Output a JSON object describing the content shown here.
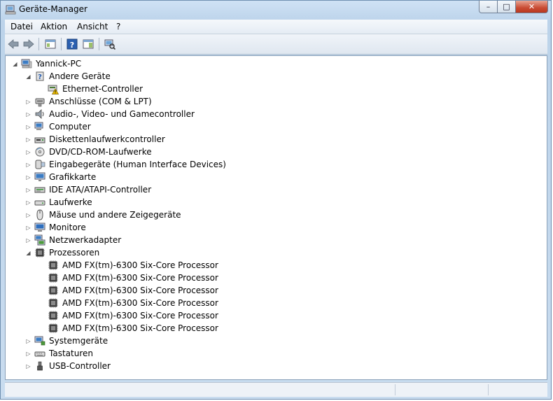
{
  "window": {
    "title": "Geräte-Manager",
    "minimize": "–",
    "maximize": "□",
    "close": "✕"
  },
  "menu": [
    {
      "label": "Datei"
    },
    {
      "label": "Aktion"
    },
    {
      "label": "Ansicht"
    },
    {
      "label": "?"
    }
  ],
  "toolbar": [
    {
      "name": "back-arrow-icon"
    },
    {
      "name": "forward-arrow-icon"
    },
    {
      "name": "show-hide-console-tree-icon"
    },
    {
      "name": "help-icon"
    },
    {
      "name": "properties-panel-icon"
    },
    {
      "name": "scan-hardware-icon"
    }
  ],
  "tree": {
    "root": "Yannick-PC",
    "items": [
      {
        "label": "Andere Geräte",
        "expanded": true
      },
      {
        "label": "Ethernet-Controller",
        "warning": true
      },
      {
        "label": "Anschlüsse (COM & LPT)"
      },
      {
        "label": "Audio-, Video- und Gamecontroller"
      },
      {
        "label": "Computer"
      },
      {
        "label": "Diskettenlaufwerkcontroller"
      },
      {
        "label": "DVD/CD-ROM-Laufwerke"
      },
      {
        "label": "Eingabegeräte (Human Interface Devices)"
      },
      {
        "label": "Grafikkarte"
      },
      {
        "label": "IDE ATA/ATAPI-Controller"
      },
      {
        "label": "Laufwerke"
      },
      {
        "label": "Mäuse und andere Zeigegeräte"
      },
      {
        "label": "Monitore"
      },
      {
        "label": "Netzwerkadapter"
      },
      {
        "label": "Prozessoren",
        "expanded": true
      },
      {
        "label": "AMD FX(tm)-6300 Six-Core Processor"
      },
      {
        "label": "AMD FX(tm)-6300 Six-Core Processor"
      },
      {
        "label": "AMD FX(tm)-6300 Six-Core Processor"
      },
      {
        "label": "AMD FX(tm)-6300 Six-Core Processor"
      },
      {
        "label": "AMD FX(tm)-6300 Six-Core Processor"
      },
      {
        "label": "AMD FX(tm)-6300 Six-Core Processor"
      },
      {
        "label": "Systemgeräte"
      },
      {
        "label": "Tastaturen"
      },
      {
        "label": "USB-Controller"
      }
    ]
  },
  "colors": {
    "accent": "#3a6ea5",
    "warning": "#f2c200"
  }
}
